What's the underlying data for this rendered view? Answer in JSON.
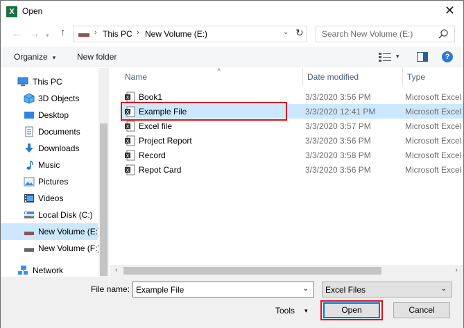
{
  "window": {
    "title": "Open",
    "app_icon": "X",
    "close_glyph": "✕"
  },
  "nav": {
    "back": "←",
    "forward": "→",
    "up": "↑",
    "breadcrumb": [
      "This PC",
      "New Volume (E:)"
    ],
    "separator": "›",
    "dropdown_glyph": "⌄",
    "refresh_glyph": "↻",
    "search_placeholder": "Search New Volume (E:)"
  },
  "toolbar": {
    "organize": "Organize",
    "new_folder": "New folder",
    "caret": "▾",
    "help": "?"
  },
  "sidebar": {
    "items": [
      {
        "label": "This PC",
        "icon": "pc-icon"
      },
      {
        "label": "3D Objects",
        "icon": "cube-icon"
      },
      {
        "label": "Desktop",
        "icon": "desktop-icon"
      },
      {
        "label": "Documents",
        "icon": "document-icon"
      },
      {
        "label": "Downloads",
        "icon": "download-icon"
      },
      {
        "label": "Music",
        "icon": "music-icon"
      },
      {
        "label": "Pictures",
        "icon": "pictures-icon"
      },
      {
        "label": "Videos",
        "icon": "video-icon"
      },
      {
        "label": "Local Disk (C:)",
        "icon": "drive-icon"
      },
      {
        "label": "New Volume (E:)",
        "icon": "drive-icon",
        "selected": true
      },
      {
        "label": "New Volume (F:)",
        "icon": "drive-icon"
      },
      {
        "label": "Network",
        "icon": "network-icon"
      }
    ]
  },
  "columns": {
    "name": "Name",
    "date": "Date modified",
    "type": "Type",
    "sort_glyph": "^"
  },
  "files": [
    {
      "name": "Book1",
      "date": "3/3/2020 3:56 PM",
      "type": "Microsoft Excel W"
    },
    {
      "name": "Example File",
      "date": "3/3/2020 12:41 PM",
      "type": "Microsoft Excel W",
      "selected": true
    },
    {
      "name": "Excel file",
      "date": "3/3/2020 3:57 PM",
      "type": "Microsoft Excel W"
    },
    {
      "name": "Project Report",
      "date": "3/3/2020 3:56 PM",
      "type": "Microsoft Excel W"
    },
    {
      "name": "Record",
      "date": "3/3/2020 3:58 PM",
      "type": "Microsoft Excel W"
    },
    {
      "name": "Repot Card",
      "date": "3/3/2020 3:56 PM",
      "type": "Microsoft Excel W"
    }
  ],
  "scroll": {
    "left": "‹",
    "right": "›"
  },
  "bottom": {
    "file_name_label": "File name:",
    "file_name_value": "Example File",
    "dropdown_glyph": "⌄",
    "filter": "Excel Files",
    "tools": "Tools",
    "tools_caret": "▾",
    "open": "Open",
    "cancel": "Cancel"
  },
  "colors": {
    "selection": "#cce8ff",
    "highlight_box": "#e0101a",
    "accent": "#0078d7"
  }
}
